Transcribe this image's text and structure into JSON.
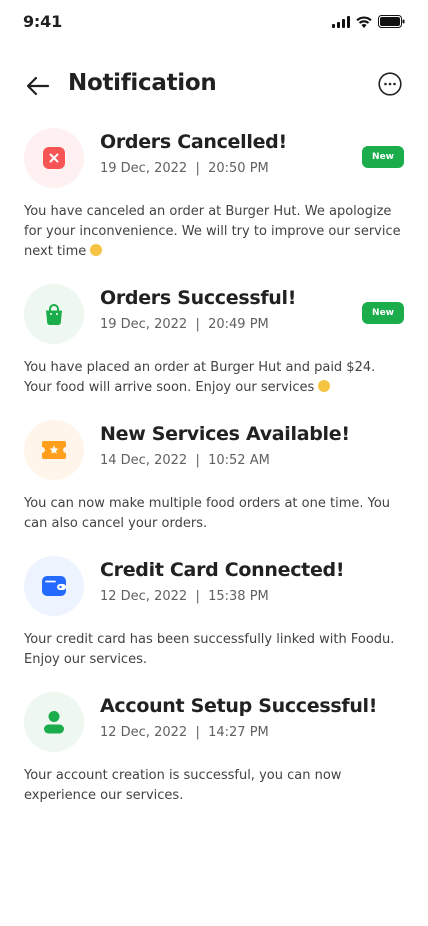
{
  "status_bar": {
    "time": "9:41"
  },
  "header": {
    "title": "Notification"
  },
  "notifications": [
    {
      "title": "Orders Cancelled!",
      "date": "19 Dec, 2022",
      "time": "20:50 PM",
      "badge": "New",
      "body": "You have canceled an order at Burger Hut. We apologize for your inconvenience. We will try to improve our service next time",
      "icon": "cancel-icon"
    },
    {
      "title": "Orders Successful!",
      "date": "19 Dec, 2022",
      "time": "20:49 PM",
      "badge": "New",
      "body": "You have placed an order at Burger Hut and paid $24. Your food will arrive soon. Enjoy our services",
      "icon": "shopping-bag-icon"
    },
    {
      "title": "New Services Available!",
      "date": "14 Dec, 2022",
      "time": "10:52 AM",
      "body": "You can now make multiple food orders at one time. You can also cancel your orders.",
      "icon": "ticket-star-icon"
    },
    {
      "title": "Credit Card Connected!",
      "date": "12 Dec, 2022",
      "time": "15:38 PM",
      "body": "Your credit card has been successfully linked with Foodu. Enjoy our services.",
      "icon": "wallet-icon"
    },
    {
      "title": "Account Setup Successful!",
      "date": "12 Dec, 2022",
      "time": "14:27 PM",
      "body": "Your account creation is successful, you can now experience our services.",
      "icon": "user-icon"
    }
  ],
  "colors": {
    "accent_green": "#1BAC4B",
    "red_bg": "#FFF0F1",
    "red": "#F75555",
    "green_bg": "#EEF8F1",
    "orange_bg": "#FFF5EA",
    "orange": "#FF9F1C",
    "blue_bg": "#EEF4FF",
    "blue": "#246BFD"
  }
}
